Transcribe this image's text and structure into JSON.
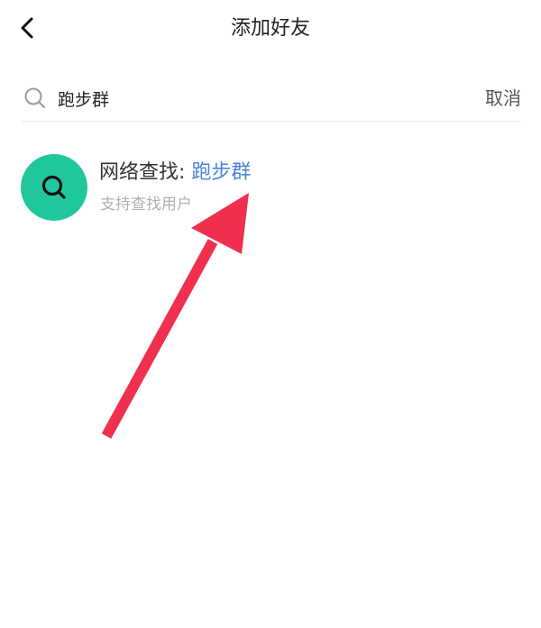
{
  "header": {
    "title": "添加好友",
    "back_icon": "chevron-left-icon"
  },
  "search": {
    "query": "跑步群",
    "icon": "search-icon",
    "cancel_label": "取消"
  },
  "result": {
    "title_prefix": "网络查找: ",
    "keyword": "跑步群",
    "subtitle": "支持查找用户",
    "icon": "search-icon",
    "avatar_color": "#21c79c",
    "keyword_color": "#4b84d8"
  },
  "annotation": {
    "icon": "arrow-icon",
    "color": "#f0304f"
  }
}
